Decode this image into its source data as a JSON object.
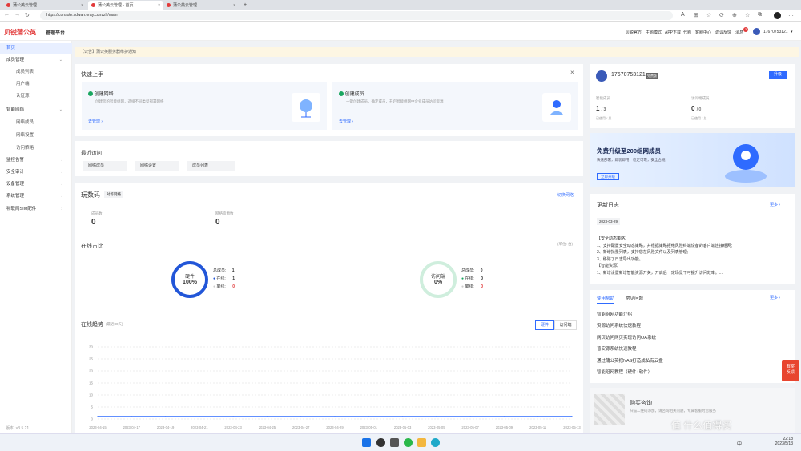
{
  "browser": {
    "tabs": [
      {
        "label": "蒲公英云管理"
      },
      {
        "label": "蒲公英云管理 - 首页"
      },
      {
        "label": "蒲公英云管理"
      }
    ],
    "url": "https://console.sdwan.oray.com/zh/main"
  },
  "header": {
    "logo": "贝锐蒲公英",
    "product": "管理平台",
    "links": [
      "贝锐官方",
      "主题模式",
      "APP下载",
      "代购",
      "客服中心",
      "建议反馈",
      "消息"
    ],
    "msg_badge": "3",
    "user": "17670753121"
  },
  "sidebar": {
    "items": [
      {
        "label": "首页",
        "active": true
      },
      {
        "label": "成员管理",
        "expandable": true
      },
      {
        "label": "成员列表",
        "sub": true
      },
      {
        "label": "用户端",
        "sub": true
      },
      {
        "label": "认证源",
        "sub": true
      },
      {
        "label": "智能网络",
        "expandable": true
      },
      {
        "label": "网络成员",
        "sub": true
      },
      {
        "label": "网络设置",
        "sub": true
      },
      {
        "label": "访问策略",
        "sub": true
      },
      {
        "label": "监控告警",
        "expandable": true
      },
      {
        "label": "安全审计",
        "expandable": true
      },
      {
        "label": "设备管理",
        "expandable": true
      },
      {
        "label": "系统管理",
        "expandable": true
      },
      {
        "label": "物联网SIM配件",
        "expandable": true
      }
    ],
    "version": "版本: v3.5.21"
  },
  "notice": "【公告】蒲公英服务器维护通知",
  "quickstart": {
    "title": "快速上手",
    "close": "×",
    "cards": [
      {
        "title": "创建网络",
        "desc": "创建您的智能组网，选择不同类型部署网络",
        "link": "去管理"
      },
      {
        "title": "创建成员",
        "desc": "一键创建成员，确定成员，开启智能组网中企业成员访问资源",
        "link": "去管理"
      }
    ]
  },
  "recent": {
    "title": "最近访问",
    "items": [
      "网络成员",
      "网络设置",
      "成员列表"
    ]
  },
  "play_code": {
    "title": "玩数码",
    "tag": "对等网络",
    "link": "切换网络",
    "stats": [
      {
        "label": "成员数",
        "value": "0"
      },
      {
        "label": "网络资源数",
        "value": "0"
      }
    ]
  },
  "online_ratio": {
    "title": "在线占比",
    "unit": "(单位: 台)",
    "groups": [
      {
        "name": "硬件",
        "pct": "100%",
        "total_label": "总成员:",
        "total": "1",
        "online_label": "在线:",
        "online": "1",
        "offline_label": "离线:",
        "offline": "0"
      },
      {
        "name": "访问端",
        "pct": "0%",
        "total_label": "总成员:",
        "total": "0",
        "online_label": "在线:",
        "online": "0",
        "offline_label": "离线:",
        "offline": "0"
      }
    ]
  },
  "trend": {
    "title": "在线趋势",
    "sub": "(最近30天)",
    "tabs": [
      "硬件",
      "访问端"
    ]
  },
  "chart_data": {
    "type": "line",
    "x": [
      "2023-04-15",
      "2023-04-17",
      "2023-04-19",
      "2023-04-21",
      "2023-04-23",
      "2023-04-25",
      "2023-04-27",
      "2023-04-29",
      "2023-05-01",
      "2023-05-03",
      "2023-05-05",
      "2023-05-07",
      "2023-05-09",
      "2023-05-11",
      "2023-05-13"
    ],
    "series": [
      {
        "values": [
          1,
          1,
          1,
          1,
          1,
          1,
          1,
          1,
          1,
          1,
          1,
          1,
          1,
          1,
          1
        ]
      }
    ],
    "yticks": [
      "0",
      "5",
      "10",
      "15",
      "20",
      "25",
      "30"
    ],
    "ylim": [
      0,
      30
    ],
    "color": "#2f6bff"
  },
  "account": {
    "phone": "17670753121",
    "badge": "免费版",
    "upgrade": "升级",
    "stats": [
      {
        "label": "智能成员",
        "value": "1",
        "total": "/ 3",
        "sub": "已使用 / 总"
      },
      {
        "label": "访问端成员",
        "value": "0",
        "total": "/ 0",
        "sub": "已使用 / 总"
      }
    ]
  },
  "promo": {
    "title": "免费升级至200组网成员",
    "desc": "快速部署，即装即用，稳定可靠，安全合规",
    "button": "立即升级"
  },
  "changelog": {
    "title": "更新日志",
    "more": "更多",
    "date": "2023-03-29",
    "lines": [
      "【安全动态策略】",
      "1、支持配置安全动态策略，并根据策略拒绝风险终端设备的客户端连接组网;",
      "2、新增批量列表，支持您在风险文件以及列表管理;",
      "3、移除了日志导出功能。",
      "【智能资源】",
      "1、新增设置新增智能资源开关，开启后一定场景下可提升访问效率。..."
    ]
  },
  "help": {
    "tabs": [
      "使用帮助",
      "常见问题"
    ],
    "more": "更多",
    "items": [
      "智能组网功能介绍",
      "资源访问系统快速教程",
      "网页访问网页实现访问OA系统",
      "普安源系统快速教程",
      "通过蒲公英把NAS打造成私有云盘",
      "智能组网教程（硬件+软件）"
    ]
  },
  "consult": {
    "title": "购买咨询",
    "desc": "扫描二维码添加，请咨询相关问题，专属客服为您服务"
  },
  "float_ad": "有奖\n反馈",
  "taskbar": {
    "time": "22:18",
    "date": "2023/5/13",
    "lang": "中"
  },
  "watermark": "值 什么值得买"
}
